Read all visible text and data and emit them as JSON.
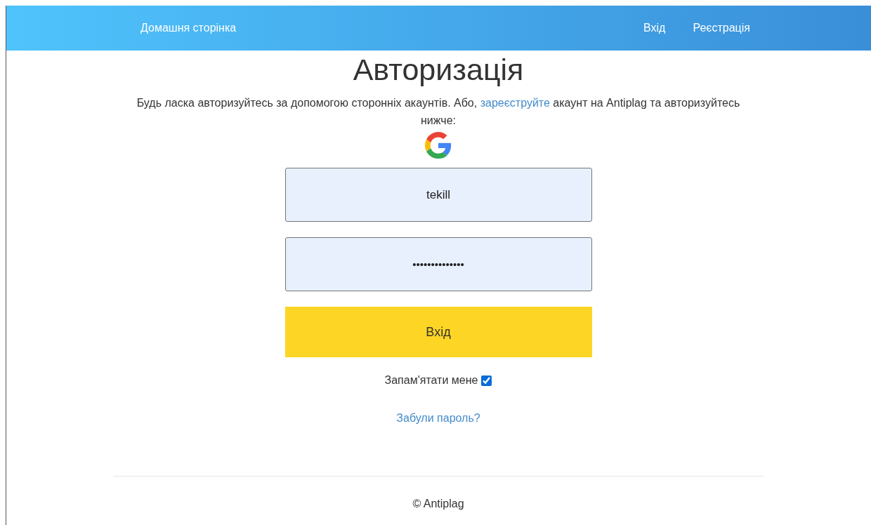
{
  "navbar": {
    "home": "Домашня сторінка",
    "links": [
      {
        "label": "Вхід"
      },
      {
        "label": "Реєстрація"
      }
    ]
  },
  "title": "Авторизація",
  "intro": {
    "before": "Будь ласка авторизуйтесь за допомогою сторонніх акаунтів. Або, ",
    "link": "зареєструйте",
    "after": " акаунт на Antiplag та авторизуйтесь нижче:"
  },
  "fields": [
    {
      "kind": "text",
      "value": "tekill"
    },
    {
      "kind": "password",
      "value": "••••••••••••••"
    }
  ],
  "submit": "Вхід",
  "remember": {
    "label": "Запам'ятати мене",
    "checked": true
  },
  "forgot": "Забули пароль?",
  "footer": "© Antiplag"
}
